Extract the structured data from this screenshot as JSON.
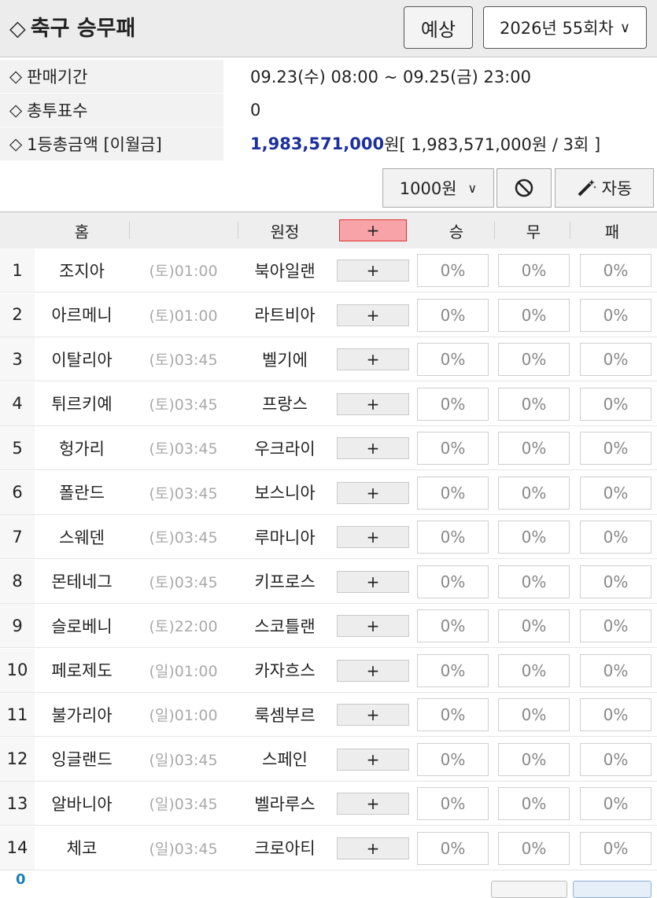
{
  "header": {
    "title_icon": "◇",
    "title": "축구 승무패",
    "predict_label": "예상",
    "round_select": "2026년 55회차",
    "round_chevron": "∨"
  },
  "info": {
    "diamond": "◇",
    "sale_period_label": "판매기간",
    "sale_period_value": "09.23(수) 08:00 ~ 09.25(금) 23:00",
    "total_votes_label": "총투표수",
    "total_votes_value": "0",
    "prize_label": "1등총금액 [이월금]",
    "prize_amount": "1,983,571,000",
    "prize_unit": "원",
    "prize_carryover": " [ 1,983,571,000원 / 3회 ]"
  },
  "controls": {
    "amount": "1000원",
    "amount_chevron": "∨",
    "cancel_icon": "prohibited-icon",
    "auto_icon": "magic-wand-icon",
    "auto_label": "자동"
  },
  "table": {
    "columns": {
      "home": "홈",
      "away": "원정",
      "plus_all": "+",
      "win": "승",
      "draw": "무",
      "lose": "패"
    },
    "plus_label": "+",
    "rows": [
      {
        "no": "1",
        "home": "조지아",
        "time": "(토)01:00",
        "away": "북아일랜",
        "win": "0%",
        "draw": "0%",
        "lose": "0%"
      },
      {
        "no": "2",
        "home": "아르메니",
        "time": "(토)01:00",
        "away": "라트비아",
        "win": "0%",
        "draw": "0%",
        "lose": "0%"
      },
      {
        "no": "3",
        "home": "이탈리아",
        "time": "(토)03:45",
        "away": "벨기에",
        "win": "0%",
        "draw": "0%",
        "lose": "0%"
      },
      {
        "no": "4",
        "home": "튀르키예",
        "time": "(토)03:45",
        "away": "프랑스",
        "win": "0%",
        "draw": "0%",
        "lose": "0%"
      },
      {
        "no": "5",
        "home": "헝가리",
        "time": "(토)03:45",
        "away": "우크라이",
        "win": "0%",
        "draw": "0%",
        "lose": "0%"
      },
      {
        "no": "6",
        "home": "폴란드",
        "time": "(토)03:45",
        "away": "보스니아",
        "win": "0%",
        "draw": "0%",
        "lose": "0%"
      },
      {
        "no": "7",
        "home": "스웨덴",
        "time": "(토)03:45",
        "away": "루마니아",
        "win": "0%",
        "draw": "0%",
        "lose": "0%"
      },
      {
        "no": "8",
        "home": "몬테네그",
        "time": "(토)03:45",
        "away": "키프로스",
        "win": "0%",
        "draw": "0%",
        "lose": "0%"
      },
      {
        "no": "9",
        "home": "슬로베니",
        "time": "(토)22:00",
        "away": "스코틀랜",
        "win": "0%",
        "draw": "0%",
        "lose": "0%"
      },
      {
        "no": "10",
        "home": "페로제도",
        "time": "(일)01:00",
        "away": "카자흐스",
        "win": "0%",
        "draw": "0%",
        "lose": "0%"
      },
      {
        "no": "11",
        "home": "불가리아",
        "time": "(일)01:00",
        "away": "룩셈부르",
        "win": "0%",
        "draw": "0%",
        "lose": "0%"
      },
      {
        "no": "12",
        "home": "잉글랜드",
        "time": "(일)03:45",
        "away": "스페인",
        "win": "0%",
        "draw": "0%",
        "lose": "0%"
      },
      {
        "no": "13",
        "home": "알바니아",
        "time": "(일)03:45",
        "away": "벨라루스",
        "win": "0%",
        "draw": "0%",
        "lose": "0%"
      },
      {
        "no": "14",
        "home": "체코",
        "time": "(일)03:45",
        "away": "크로아티",
        "win": "0%",
        "draw": "0%",
        "lose": "0%"
      }
    ]
  },
  "footer": {
    "count": "0"
  }
}
